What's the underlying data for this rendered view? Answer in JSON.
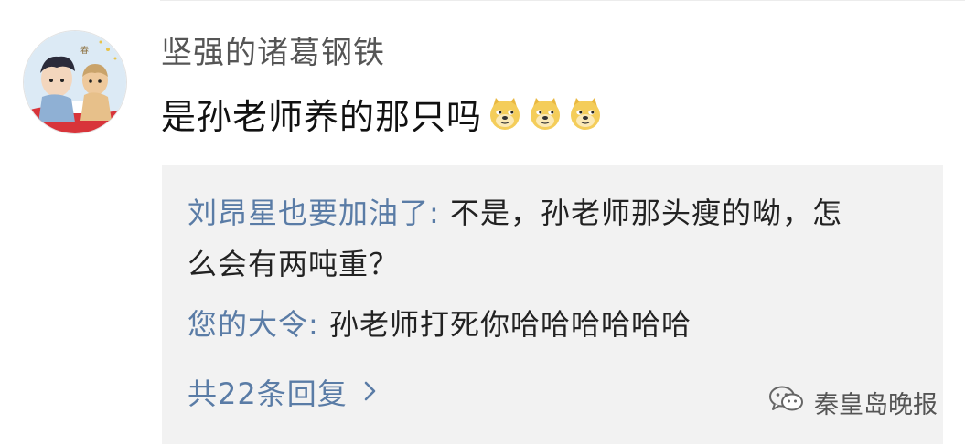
{
  "comment": {
    "author": "坚强的诸葛钢铁",
    "text": "是孙老师养的那只吗",
    "emojis": [
      "doge-emoji",
      "doge-emoji",
      "doge-emoji"
    ]
  },
  "replies": [
    {
      "name": "刘昂星也要加油了",
      "separator": ": ",
      "text": "不是，孙老师那头瘦的呦，怎么会有两吨重？"
    },
    {
      "name": "您的大令",
      "separator": ": ",
      "text": "孙老师打死你哈哈哈哈哈哈"
    }
  ],
  "more_replies": {
    "label": "共22条回复",
    "icon": "chevron-right-icon"
  },
  "watermark": {
    "text": "秦皇岛晚报",
    "icon": "wechat-icon"
  },
  "colors": {
    "link": "#5a7ca6",
    "reply_bg": "#f2f2f2",
    "username": "#555555"
  }
}
